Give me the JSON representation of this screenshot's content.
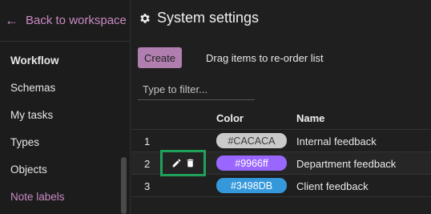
{
  "sidebar": {
    "back_label": "Back to workspace",
    "items": [
      {
        "label": "Workflow"
      },
      {
        "label": "Schemas"
      },
      {
        "label": "My tasks"
      },
      {
        "label": "Types"
      },
      {
        "label": "Objects"
      },
      {
        "label": "Note labels"
      }
    ],
    "accent": "#c98ac5"
  },
  "header": {
    "title": "System settings",
    "icon": "gear-icon"
  },
  "toolbar": {
    "create_label": "Create",
    "hint": "Drag items to re-order list"
  },
  "filter": {
    "placeholder": "Type to filter...",
    "value": ""
  },
  "table": {
    "columns": [
      "",
      "Color",
      "Name"
    ],
    "rows": [
      {
        "num": "1",
        "color": "#CACACA",
        "swatch": "#cacaca",
        "text": "#3a3a3a",
        "name": "Internal feedback"
      },
      {
        "num": "2",
        "color": "#9966ff",
        "swatch": "#9966ff",
        "text": "#ffffff",
        "name": "Department feedback"
      },
      {
        "num": "3",
        "color": "#3498DB",
        "swatch": "#3498db",
        "text": "#ffffff",
        "name": "Client feedback"
      }
    ],
    "row_actions_icons": [
      "pencil-icon",
      "trash-icon"
    ]
  }
}
